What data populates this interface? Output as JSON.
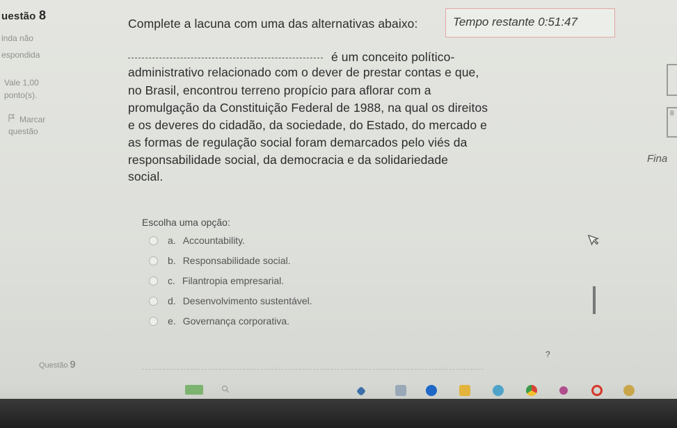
{
  "sidebar": {
    "question_label": "uestão",
    "question_number": "8",
    "status_line1": "inda não",
    "status_line2": "espondida",
    "value_line1": "Vale 1,00",
    "value_line2": "ponto(s).",
    "flag_label": "Marcar",
    "flag_label2": "questão"
  },
  "timer": {
    "label": "Tempo restante",
    "value": "0:51:47"
  },
  "question": {
    "line1": "Complete a lacuna com uma das alternativas abaixo:",
    "line2": "é um conceito político-",
    "line3": "administrativo relacionado com o dever de prestar contas e que,",
    "line4": "no Brasil, encontrou terreno propício para aflorar com a",
    "line5": "promulgação da Constituição Federal de 1988, na qual os direitos",
    "line6": "e os deveres do cidadão, da sociedade, do Estado, do mercado e",
    "line7": "as formas de regulação social foram demarcados pelo viés da",
    "line8": "responsabilidade social, da democracia e da solidariedade",
    "line9": "social."
  },
  "choose_label": "Escolha uma opção:",
  "options": [
    {
      "letter": "a.",
      "text": "Accountability."
    },
    {
      "letter": "b.",
      "text": "Responsabilidade social."
    },
    {
      "letter": "c.",
      "text": "Filantropia empresarial."
    },
    {
      "letter": "d.",
      "text": "Desenvolvimento sustentável."
    },
    {
      "letter": "e.",
      "text": "Governança corporativa."
    }
  ],
  "right_fragments": {
    "fina": "Fina",
    "box_digit": "8",
    "qmark": "?"
  },
  "next_question": {
    "label": "Questão",
    "number": "9"
  },
  "colors": {
    "timer_border": "#e3a7a3",
    "background": "#e4e5e0"
  }
}
